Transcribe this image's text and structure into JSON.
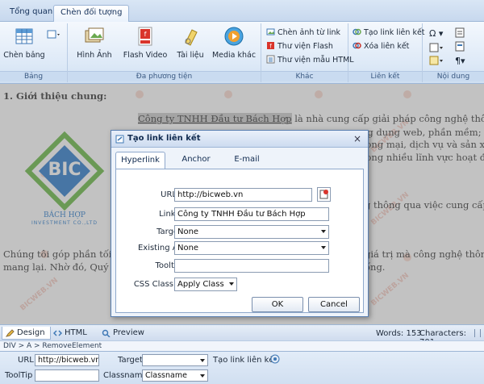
{
  "ribbon": {
    "tabs": [
      {
        "label": "Tổng quan"
      },
      {
        "label": "Chèn đối tượng"
      }
    ],
    "groups": {
      "bang": {
        "label": "Bảng",
        "buttons": [
          {
            "label": "Chèn bảng",
            "icon": "table-icon"
          }
        ]
      },
      "multimedia": {
        "label": "Đa phương tiện",
        "buttons": [
          {
            "label": "Hình Ảnh",
            "icon": "image-icon"
          },
          {
            "label": "Flash Video",
            "icon": "flash-video-icon"
          },
          {
            "label": "Tài liệu",
            "icon": "document-icon"
          },
          {
            "label": "Media khác",
            "icon": "media-player-icon"
          }
        ]
      },
      "khac": {
        "label": "Khác",
        "items": [
          {
            "label": "Chèn ảnh từ link",
            "icon": "image-link-icon"
          },
          {
            "label": "Thư viện Flash",
            "icon": "flash-library-icon"
          },
          {
            "label": "Thư viện mẫu HTML",
            "icon": "html-template-icon"
          }
        ]
      },
      "lienket": {
        "label": "Liên kết",
        "items": [
          {
            "label": "Tạo link liên kết",
            "icon": "link-icon"
          },
          {
            "label": "Xóa liên kết",
            "icon": "unlink-icon"
          }
        ]
      },
      "noidung": {
        "label": "Nội dung"
      }
    }
  },
  "editor": {
    "heading": "1. Giới thiệu chung:",
    "line1_link": "Công ty TNHH Đầu tư Bách Hợp",
    "line1_rest": " là nhà cung cấp giải pháp công nghệ thông tin chuyên",
    "line2_right": "ng dụng web, phần mềm; Gia",
    "line3_right": "rong mại, dịch vụ và sản xuất.",
    "line4_right": "rong nhiều lĩnh vực hoạt động",
    "line5_right": "g thông qua việc cung cấp sản",
    "line6_left": "Chúng tôi góp phần tối ưu",
    "line6_right": "giá trị mà công nghệ thông tin",
    "line7_left": "mang lại. Nhờ đó, Quý khá",
    "line7_right": "ống.",
    "logo_text": "BIC",
    "logo_sub": "BÁCH HỢP",
    "logo_tag": "INVESTMENT CO.,LTD",
    "watermark": "BICWEB.VN"
  },
  "dialog": {
    "title": "Tạo link liên kết",
    "tabs": [
      "Hyperlink",
      "Anchor",
      "E-mail"
    ],
    "fields": {
      "url": {
        "label": "URL",
        "value": "http://bicweb.vn"
      },
      "link_text": {
        "label": "Link Text",
        "value": "Công ty TNHH Đầu tư Bách Hợp"
      },
      "target": {
        "label": "Target",
        "value": "None"
      },
      "existing_anchor": {
        "label": "Existing Anchor",
        "value": "None"
      },
      "tooltip": {
        "label": "Tooltip",
        "value": ""
      },
      "css_class": {
        "label": "CSS Class",
        "value": "Apply Class"
      }
    },
    "ok": "OK",
    "cancel": "Cancel"
  },
  "modes": [
    {
      "label": "Design",
      "icon": "pencil-icon"
    },
    {
      "label": "HTML",
      "icon": "code-icon"
    },
    {
      "label": "Preview",
      "icon": "magnifier-icon"
    }
  ],
  "status": {
    "words": "Words: 153",
    "characters": "Characters: 701"
  },
  "path": "DIV > A > RemoveElement",
  "props": {
    "url_label": "URL",
    "url_value": "http://bicweb.vn",
    "target_label": "Target",
    "link_label": "Tạo link liên kết",
    "tooltip_label": "ToolTip",
    "classname_label": "Classname",
    "classname_value": "Classname"
  },
  "colors": {
    "accent": "#5a7fb0",
    "logo_blue": "#1f74c8",
    "logo_green": "#5fb53a",
    "watermark": "#e8826a"
  }
}
